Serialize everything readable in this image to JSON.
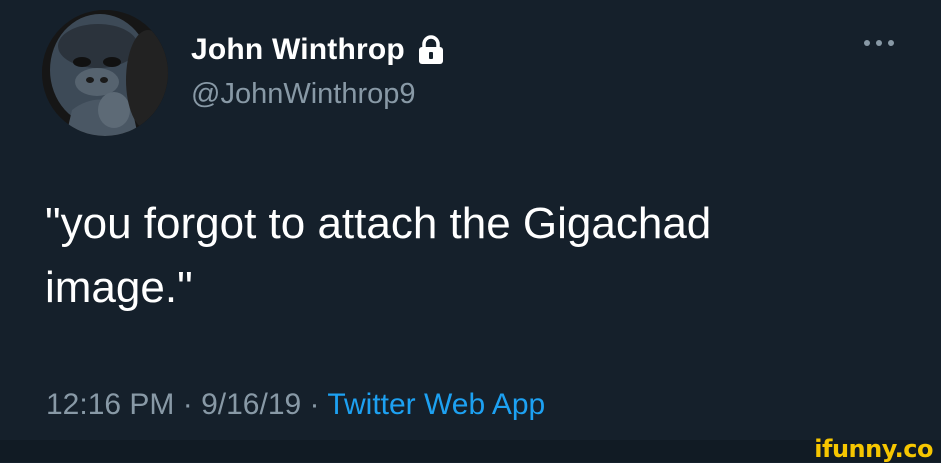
{
  "tweet": {
    "author": {
      "display_name": "John Winthrop",
      "handle": "@JohnWinthrop9",
      "protected_icon": "lock-icon",
      "avatar_icon": "gorilla-avatar"
    },
    "text_line_1": "\"you forgot to attach the Gigachad",
    "text_line_2": "image.\"",
    "time": "12:16 PM",
    "separator_1": " · ",
    "date": "9/16/19",
    "separator_2": " · ",
    "source": "Twitter Web App",
    "more_icon": "more-options-icon"
  },
  "watermark": {
    "text": "ifunny.co"
  },
  "colors": {
    "background": "#15202b",
    "primary_text": "#ffffff",
    "secondary_text": "#8899a6",
    "link": "#1da1f2",
    "watermark": "#f6c600"
  }
}
